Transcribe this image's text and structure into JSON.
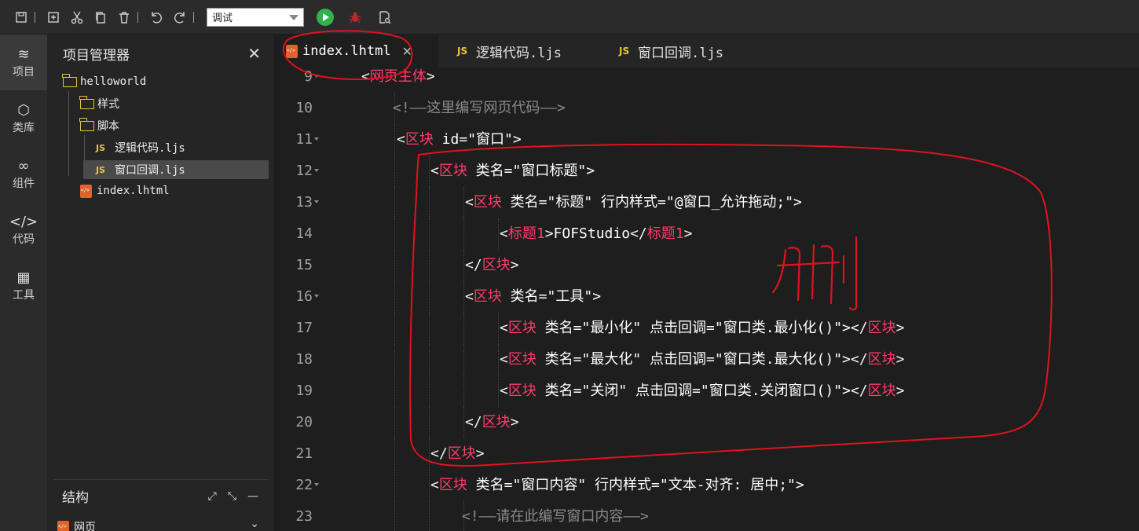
{
  "toolbar": {
    "mode_value": "调试"
  },
  "activity": [
    {
      "label": "项目",
      "icon": "layers-icon",
      "glyph": "≋"
    },
    {
      "label": "类库",
      "icon": "cube-icon",
      "glyph": "⬡"
    },
    {
      "label": "组件",
      "icon": "link-icon",
      "glyph": "∞"
    },
    {
      "label": "代码",
      "icon": "code-icon",
      "glyph": "</>"
    },
    {
      "label": "工具",
      "icon": "tools-icon",
      "glyph": "▦"
    }
  ],
  "sidebar": {
    "title": "项目管理器",
    "tree": [
      {
        "label": "helloworld",
        "type": "folder"
      },
      {
        "label": "样式",
        "type": "folder"
      },
      {
        "label": "脚本",
        "type": "folder"
      },
      {
        "label": "逻辑代码.ljs",
        "type": "js"
      },
      {
        "label": "窗口回调.ljs",
        "type": "js"
      },
      {
        "label": "index.lhtml",
        "type": "html"
      }
    ],
    "structure_title": "结构",
    "structure_root": "网页"
  },
  "tabs": [
    {
      "label": "index.lhtml",
      "icon": "html"
    },
    {
      "label": "逻辑代码.ljs",
      "icon": "js"
    },
    {
      "label": "窗口回调.ljs",
      "icon": "js"
    }
  ],
  "editor": {
    "lines": [
      {
        "n": "9",
        "fold": true,
        "text": "<网页主体>"
      },
      {
        "n": "10",
        "fold": false,
        "text": "<!——这里编写网页代码——>"
      },
      {
        "n": "11",
        "fold": true,
        "text": "<区块 id=\"窗口\">"
      },
      {
        "n": "12",
        "fold": true,
        "text": "<区块 类名=\"窗口标题\">"
      },
      {
        "n": "13",
        "fold": true,
        "text": "<区块 类名=\"标题\" 行内样式=\"@窗口_允许拖动;\">"
      },
      {
        "n": "14",
        "fold": false,
        "text": "<标题1>FOFStudio</标题1>"
      },
      {
        "n": "15",
        "fold": false,
        "text": "</区块>"
      },
      {
        "n": "16",
        "fold": true,
        "text": "<区块 类名=\"工具\">"
      },
      {
        "n": "17",
        "fold": false,
        "text": "<区块 类名=\"最小化\" 点击回调=\"窗口类.最小化()\"></区块>"
      },
      {
        "n": "18",
        "fold": false,
        "text": "<区块 类名=\"最大化\" 点击回调=\"窗口类.最大化()\"></区块>"
      },
      {
        "n": "19",
        "fold": false,
        "text": "<区块 类名=\"关闭\" 点击回调=\"窗口类.关闭窗口()\"></区块>"
      },
      {
        "n": "20",
        "fold": false,
        "text": "</区块>"
      },
      {
        "n": "21",
        "fold": false,
        "text": "</区块>"
      },
      {
        "n": "22",
        "fold": true,
        "text": "<区块 类名=\"窗口内容\" 行内样式=\"文本-对齐: 居中;\">"
      },
      {
        "n": "23",
        "fold": false,
        "text": "<!——请在此编写窗口内容——>"
      }
    ]
  },
  "annotation": {
    "text": "删",
    "color": "#e0121e"
  }
}
